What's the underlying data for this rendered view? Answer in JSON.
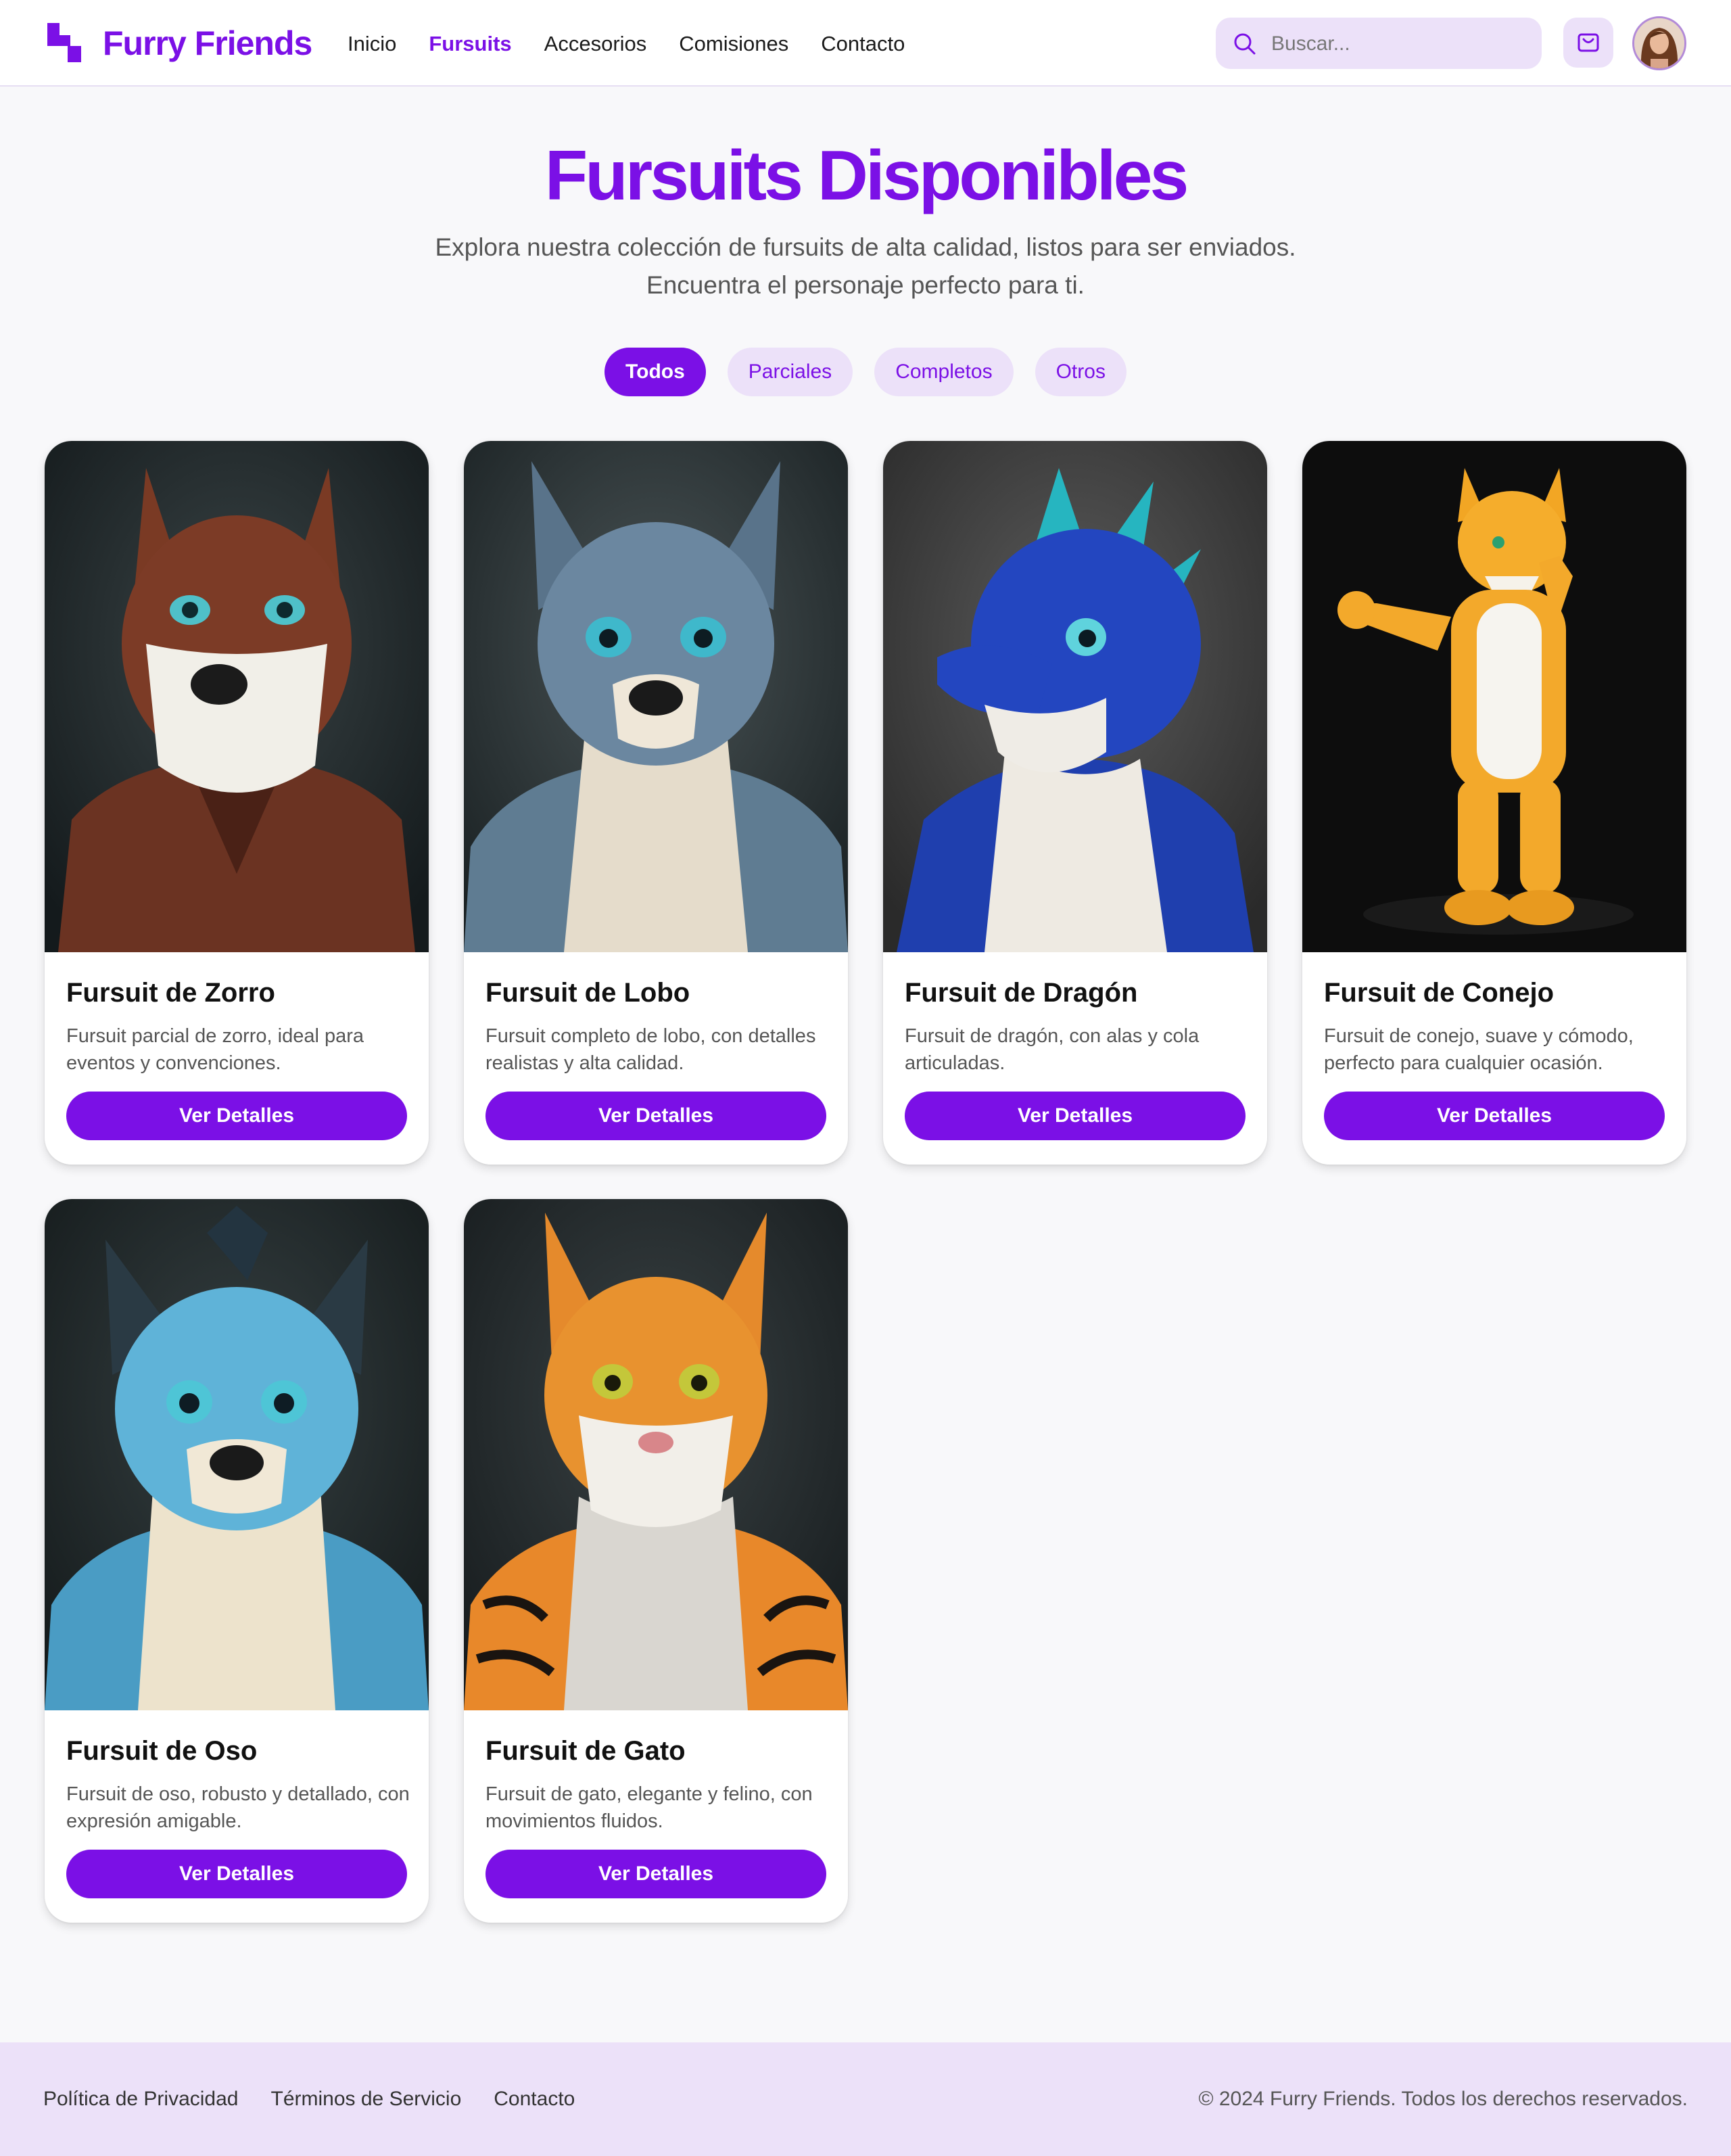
{
  "header": {
    "brand": "Furry Friends",
    "nav": [
      "Inicio",
      "Fursuits",
      "Accesorios",
      "Comisiones",
      "Contacto"
    ],
    "active_nav": "Fursuits",
    "search_placeholder": "Buscar...",
    "brand_color": "#7b10e6"
  },
  "hero": {
    "title": "Fursuits Disponibles",
    "subtitle_line1": "Explora nuestra colección de fursuits de alta calidad, listos para ser enviados.",
    "subtitle_line2": "Encuentra el personaje perfecto para ti."
  },
  "filters": {
    "items": [
      "Todos",
      "Parciales",
      "Completos",
      "Otros"
    ],
    "active": "Todos"
  },
  "products": [
    {
      "title": "Fursuit de Zorro",
      "desc": "Fursuit parcial de zorro, ideal para eventos y convenciones.",
      "button": "Ver Detalles",
      "image": "brown wolf fursuit in coat"
    },
    {
      "title": "Fursuit de Lobo",
      "desc": "Fursuit completo de lobo, con detalles realistas y alta calidad.",
      "button": "Ver Detalles",
      "image": "grey-blue wolf fursuit"
    },
    {
      "title": "Fursuit de Dragón",
      "desc": "Fursuit de dragón, con alas y cola articuladas.",
      "button": "Ver Detalles",
      "image": "blue dragon fursuit"
    },
    {
      "title": "Fursuit de Conejo",
      "desc": "Fursuit de conejo, suave y cómodo, perfecto para cualquier ocasión.",
      "button": "Ver Detalles",
      "image": "orange full-body fursuit waving"
    },
    {
      "title": "Fursuit de Oso",
      "desc": "Fursuit de oso, robusto y detallado, con expresión amigable.",
      "button": "Ver Detalles",
      "image": "light blue canine fursuit"
    },
    {
      "title": "Fursuit de Gato",
      "desc": "Fursuit de gato, elegante y felino, con movimientos fluidos.",
      "button": "Ver Detalles",
      "image": "tiger cat fursuit"
    }
  ],
  "footer": {
    "links": [
      "Política de Privacidad",
      "Términos de Servicio",
      "Contacto"
    ],
    "copyright": "© 2024 Furry Friends. Todos los derechos reservados."
  }
}
